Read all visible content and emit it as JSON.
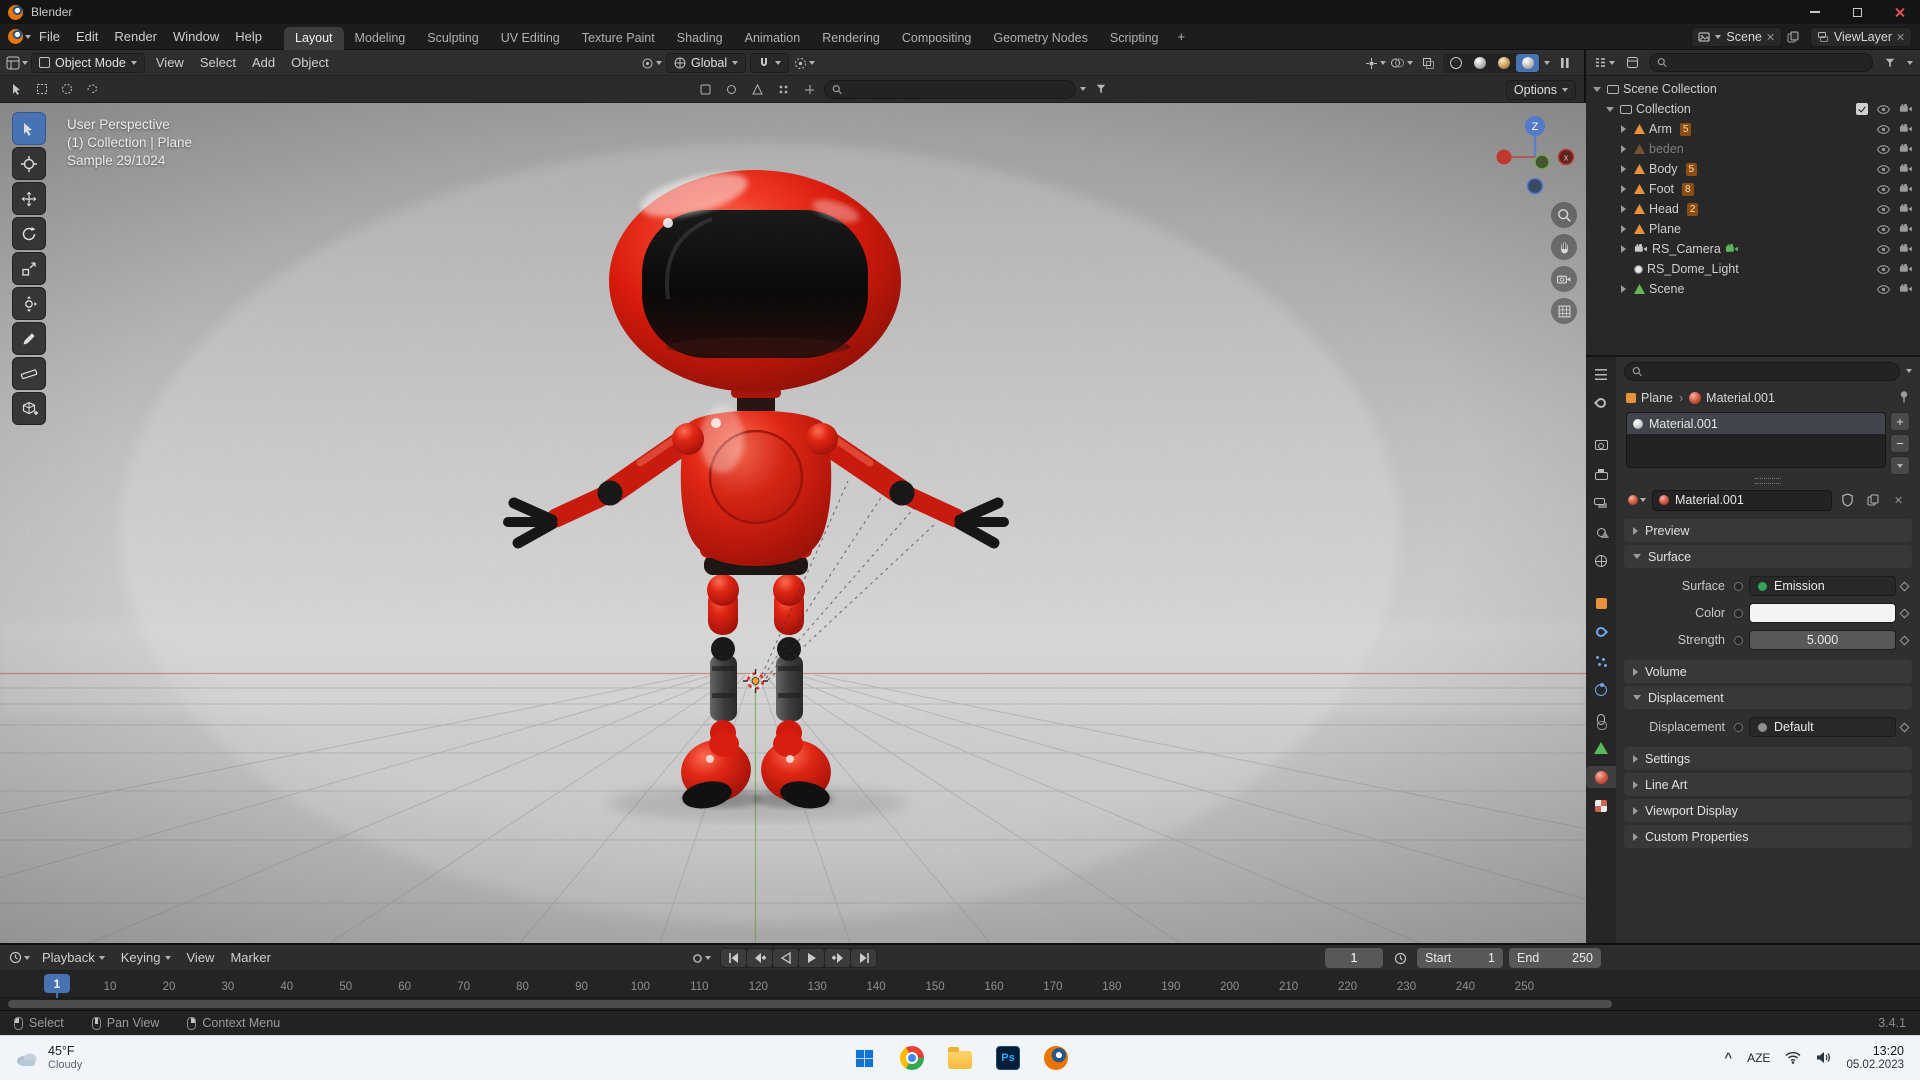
{
  "titlebar": {
    "title": "Blender"
  },
  "topbar": {
    "menus": [
      "File",
      "Edit",
      "Render",
      "Window",
      "Help"
    ],
    "workspaces": [
      "Layout",
      "Modeling",
      "Sculpting",
      "UV Editing",
      "Texture Paint",
      "Shading",
      "Animation",
      "Rendering",
      "Compositing",
      "Geometry Nodes",
      "Scripting"
    ],
    "active_workspace": "Layout",
    "add_tab": "+",
    "scene_name": "Scene",
    "viewlayer_name": "ViewLayer"
  },
  "viewport": {
    "mode": "Object Mode",
    "menus": [
      "View",
      "Select",
      "Add",
      "Object"
    ],
    "orientation": "Global",
    "options_label": "Options",
    "search_value": "",
    "overlay": [
      "User Perspective",
      "(1) Collection | Plane",
      "Sample 29/1024"
    ],
    "gizmo_z": "Z",
    "gizmo_x": "x",
    "tools": [
      "select-box",
      "cursor",
      "move",
      "rotate",
      "scale",
      "transform",
      "annotate",
      "measure",
      "add-cube"
    ]
  },
  "outliner": {
    "search_value": "",
    "scene_collection": "Scene Collection",
    "collection": "Collection",
    "items": [
      {
        "label": "Arm",
        "type": "mesh",
        "badge": "5",
        "arrow": true
      },
      {
        "label": "beden",
        "type": "mesh",
        "badge": "",
        "arrow": true,
        "dim": true
      },
      {
        "label": "Body",
        "type": "mesh",
        "badge": "5",
        "arrow": true
      },
      {
        "label": "Foot",
        "type": "mesh",
        "badge": "8",
        "arrow": true
      },
      {
        "label": "Head",
        "type": "mesh",
        "badge": "2",
        "arrow": true
      },
      {
        "label": "Plane",
        "type": "mesh",
        "badge": "",
        "arrow": true
      },
      {
        "label": "RS_Camera",
        "type": "camera",
        "badge": "",
        "arrow": true,
        "extra": "camera-data"
      },
      {
        "label": "RS_Dome_Light",
        "type": "light",
        "badge": "",
        "arrow": false
      },
      {
        "label": "Scene",
        "type": "mesh-data",
        "badge": "",
        "arrow": true
      }
    ]
  },
  "properties": {
    "search_value": "",
    "tabs": [
      "tool",
      "render",
      "output",
      "view-layer",
      "scene",
      "world",
      "object",
      "modifiers",
      "particles",
      "physics",
      "constraints",
      "object-data",
      "material",
      "texture"
    ],
    "active_tab": "material",
    "breadcrumb": {
      "object": "Plane",
      "data": "Material.001"
    },
    "slot_selected": "Material.001",
    "slot_add": "+",
    "slot_remove": "−",
    "material_name": "Material.001",
    "panels": [
      {
        "title": "Preview",
        "expanded": false
      },
      {
        "title": "Surface",
        "expanded": true,
        "rows": [
          {
            "label": "Surface",
            "value": "Emission",
            "widget": "menu",
            "socket": "#2fa556"
          },
          {
            "label": "Color",
            "value": "",
            "widget": "color"
          },
          {
            "label": "Strength",
            "value": "5.000",
            "widget": "slider"
          }
        ]
      },
      {
        "title": "Volume",
        "expanded": false
      },
      {
        "title": "Displacement",
        "expanded": true,
        "rows": [
          {
            "label": "Displacement",
            "value": "Default",
            "widget": "menu",
            "socket": "#8f8f8f"
          }
        ]
      },
      {
        "title": "Settings",
        "expanded": false
      },
      {
        "title": "Line Art",
        "expanded": false
      },
      {
        "title": "Viewport Display",
        "expanded": false
      },
      {
        "title": "Custom Properties",
        "expanded": false
      }
    ]
  },
  "timeline": {
    "menus": [
      "Playback",
      "Keying",
      "View",
      "Marker"
    ],
    "current_frame": "1",
    "start_label": "Start",
    "start_value": "1",
    "end_label": "End",
    "end_value": "250",
    "ticks": [
      1,
      10,
      20,
      30,
      40,
      50,
      60,
      70,
      80,
      90,
      100,
      110,
      120,
      130,
      140,
      150,
      160,
      170,
      180,
      190,
      200,
      210,
      220,
      230,
      240,
      250
    ]
  },
  "statusbar": {
    "hints": [
      {
        "button": "left",
        "label": "Select"
      },
      {
        "button": "middle",
        "label": "Pan View"
      },
      {
        "button": "right",
        "label": "Context Menu"
      }
    ],
    "version": "3.4.1"
  },
  "taskbar": {
    "weather_temp": "45°F",
    "weather_cond": "Cloudy",
    "apps": [
      "start",
      "chrome",
      "explorer",
      "photoshop",
      "blender"
    ],
    "photoshop_label": "Ps",
    "tray_language": "AZE",
    "time": "13:20",
    "date": "05.02.2023"
  },
  "colors": {
    "accent": "#4772b3",
    "mesh_orange": "#e8933a",
    "emission_socket": "#2fa556"
  }
}
